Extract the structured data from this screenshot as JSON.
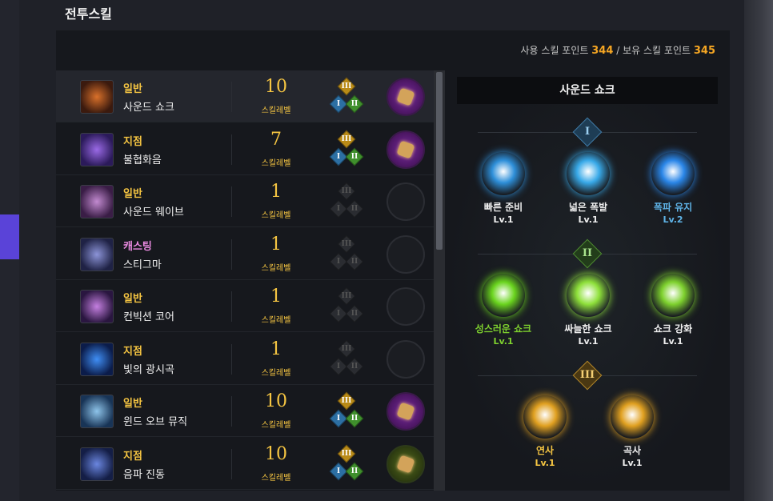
{
  "section_title": "전투스킬",
  "points": {
    "used_label": "사용 스킬 포인트",
    "used_value": "344",
    "separator": "/",
    "owned_label": "보유 스킬 포인트",
    "owned_value": "345"
  },
  "skills": [
    {
      "type": "일반",
      "type_color": "#f5c542",
      "name": "사운드 쇼크",
      "level": "10",
      "level_label": "스킬레벨",
      "tripods_active": true,
      "rune": "purple",
      "icon_colors": [
        "#3b1a0e",
        "#d9702a"
      ]
    },
    {
      "type": "지점",
      "type_color": "#f5c542",
      "name": "불협화음",
      "level": "7",
      "level_label": "스킬레벨",
      "tripods_active": true,
      "rune": "purple",
      "icon_colors": [
        "#2b1a5a",
        "#9a6ae6"
      ]
    },
    {
      "type": "일반",
      "type_color": "#f5c542",
      "name": "사운드 웨이브",
      "level": "1",
      "level_label": "스킬레벨",
      "tripods_active": false,
      "rune": "none",
      "icon_colors": [
        "#3a1d46",
        "#c28ad0"
      ]
    },
    {
      "type": "캐스팅",
      "type_color": "#e98ae0",
      "name": "스티그마",
      "level": "1",
      "level_label": "스킬레벨",
      "tripods_active": false,
      "rune": "none",
      "icon_colors": [
        "#1f2245",
        "#8c94d8"
      ]
    },
    {
      "type": "일반",
      "type_color": "#f5c542",
      "name": "컨빅션 코어",
      "level": "1",
      "level_label": "스킬레벨",
      "tripods_active": false,
      "rune": "none",
      "icon_colors": [
        "#2a1640",
        "#c47fe0"
      ]
    },
    {
      "type": "지점",
      "type_color": "#f5c542",
      "name": "빛의 광시곡",
      "level": "1",
      "level_label": "스킬레벨",
      "tripods_active": false,
      "rune": "none",
      "icon_colors": [
        "#0b1c4a",
        "#3f8ef5"
      ]
    },
    {
      "type": "일반",
      "type_color": "#f5c542",
      "name": "윈드 오브 뮤직",
      "level": "10",
      "level_label": "스킬레벨",
      "tripods_active": true,
      "rune": "purple",
      "icon_colors": [
        "#183456",
        "#8ec4ea"
      ]
    },
    {
      "type": "지점",
      "type_color": "#f5c542",
      "name": "음파 진동",
      "level": "10",
      "level_label": "스킬레벨",
      "tripods_active": true,
      "rune": "green",
      "icon_colors": [
        "#141e46",
        "#6a86e0"
      ]
    }
  ],
  "tripod_tiers": [
    "I",
    "II",
    "III"
  ],
  "tree": {
    "title": "사운드 쇼크",
    "tier1": [
      {
        "name": "빠른 준비",
        "level": "Lv.1",
        "name_color": "#f0f0f0",
        "level_color": "#f0f0f0",
        "icon": "hourglass-icon",
        "icon_color": "#2e8fd9"
      },
      {
        "name": "넓은 폭발",
        "level": "Lv.1",
        "name_color": "#f0f0f0",
        "level_color": "#f0f0f0",
        "icon": "expand-arrows-icon",
        "icon_color": "#38a9e8"
      },
      {
        "name": "폭파 유지",
        "level": "Lv.2",
        "name_color": "#5fb4e8",
        "level_color": "#5fb4e8",
        "icon": "burst-icon",
        "icon_color": "#2a86e8"
      }
    ],
    "tier2": [
      {
        "name": "성스러운 쇼크",
        "level": "Lv.1",
        "name_color": "#7ed12e",
        "level_color": "#7ed12e",
        "icon": "holy-sun-icon",
        "icon_color": "#6ad41e"
      },
      {
        "name": "싸늘한 쇼크",
        "level": "Lv.1",
        "name_color": "#f0f0f0",
        "level_color": "#f0f0f0",
        "icon": "snowflake-icon",
        "icon_color": "#8ee03a"
      },
      {
        "name": "쇼크 강화",
        "level": "Lv.1",
        "name_color": "#f0f0f0",
        "level_color": "#f0f0f0",
        "icon": "sparkle-staff-icon",
        "icon_color": "#7ed12e"
      }
    ],
    "tier3": [
      {
        "name": "연사",
        "level": "Lv.1",
        "name_color": "#f5c542",
        "level_color": "#f5c542",
        "icon": "rapid-fire-icon",
        "icon_color": "#e0a020"
      },
      {
        "name": "곡사",
        "level": "Lv.1",
        "name_color": "#f0f0f0",
        "level_color": "#f0f0f0",
        "icon": "arc-shot-icon",
        "icon_color": "#e0a020"
      }
    ]
  }
}
